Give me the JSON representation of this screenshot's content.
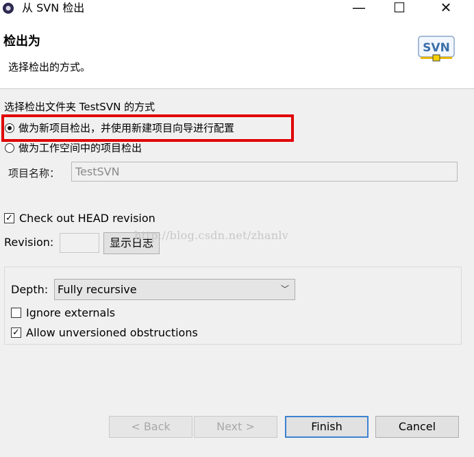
{
  "window": {
    "title": "从 SVN 检出",
    "minimize_glyph": "—",
    "maximize_glyph": "☐",
    "close_glyph": "✕"
  },
  "banner": {
    "title": "检出为",
    "subtitle": "选择检出的方式。",
    "logo_text": "SVN"
  },
  "options": {
    "group_label": "选择检出文件夹 TestSVN 的方式",
    "radio_new_project": "做为新项目检出，并使用新建项目向导进行配置",
    "radio_workspace_project": "做为工作空间中的项目检出",
    "selected": "radio_new_project"
  },
  "project": {
    "name_label": "项目名称：",
    "name_value": "TestSVN"
  },
  "revision": {
    "head_checkbox_label": "Check out HEAD revision",
    "head_checked": true,
    "revision_label": "Revision:",
    "revision_value": "",
    "show_log_button": "显示日志"
  },
  "watermark": "http://blog.csdn.net/zhanlv",
  "depth": {
    "label": "Depth:",
    "selected": "Fully recursive"
  },
  "flags": {
    "ignore_externals_label": "Ignore externals",
    "ignore_externals_checked": false,
    "allow_unversioned_label": "Allow unversioned obstructions",
    "allow_unversioned_checked": true
  },
  "buttons": {
    "back": "< Back",
    "next": "Next >",
    "finish": "Finish",
    "cancel": "Cancel"
  },
  "colors": {
    "highlight_border": "#e00000",
    "panel_background": "#f0f0f0",
    "primary_button_border": "#3c82d0"
  }
}
